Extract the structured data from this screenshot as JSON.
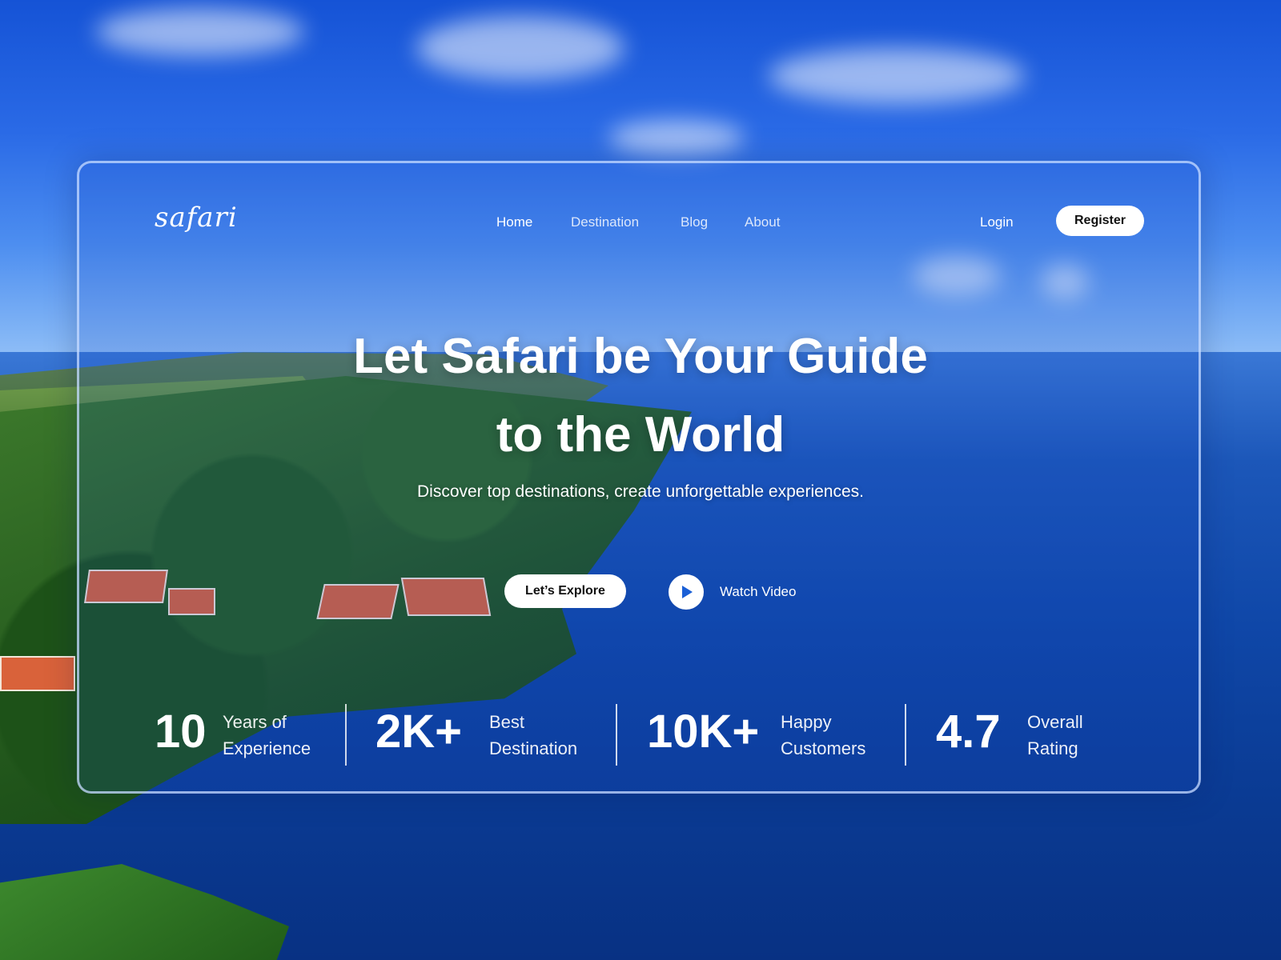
{
  "brand": {
    "logo_text": "safari"
  },
  "nav": {
    "items": [
      {
        "label": "Home"
      },
      {
        "label": "Destination"
      },
      {
        "label": "Blog"
      },
      {
        "label": "About"
      }
    ],
    "login_label": "Login",
    "register_label": "Register"
  },
  "hero": {
    "headline_line1": "Let Safari be Your Guide",
    "headline_line2": "to the World",
    "subtitle": "Discover top destinations, create unforgettable experiences.",
    "explore_label": "Let’s Explore",
    "watch_label": "Watch Video"
  },
  "stats": [
    {
      "value": "10",
      "label_line1": "Years of",
      "label_line2": "Experience"
    },
    {
      "value": "2K+",
      "label_line1": "Best",
      "label_line2": "Destination"
    },
    {
      "value": "10K+",
      "label_line1": "Happy",
      "label_line2": "Customers"
    },
    {
      "value": "4.7",
      "label_line1": "Overall",
      "label_line2": "Rating"
    }
  ],
  "icons": {
    "play": "play-icon"
  },
  "colors": {
    "accent": "#ffffff",
    "play_icon": "#1a5fd6",
    "sky": "#2a6ae6",
    "sea": "#0f47a8"
  }
}
